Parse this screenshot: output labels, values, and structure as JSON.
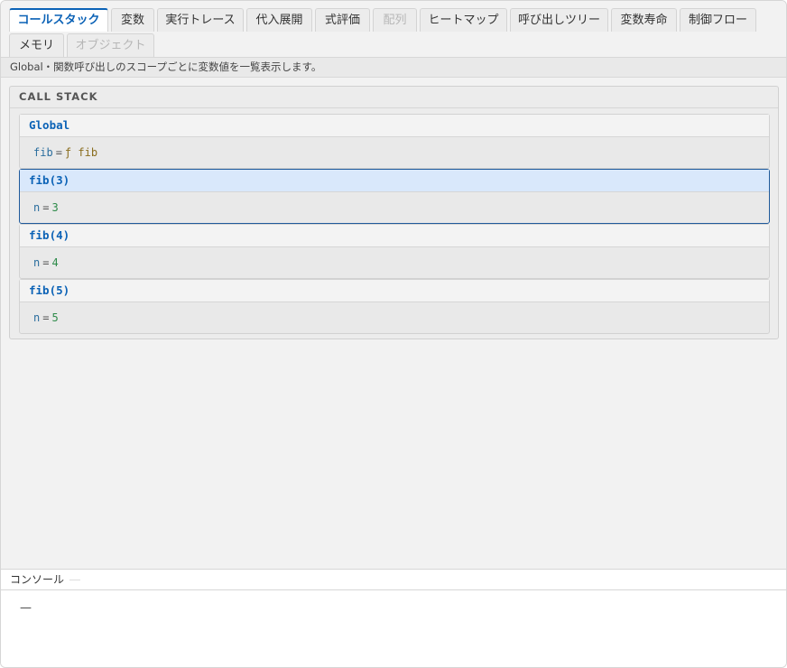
{
  "tabs": [
    {
      "label": "コールスタック",
      "state": "active"
    },
    {
      "label": "変数",
      "state": "normal"
    },
    {
      "label": "実行トレース",
      "state": "normal"
    },
    {
      "label": "代入展開",
      "state": "normal"
    },
    {
      "label": "式評価",
      "state": "normal"
    },
    {
      "label": "配列",
      "state": "disabled"
    },
    {
      "label": "ヒートマップ",
      "state": "normal"
    },
    {
      "label": "呼び出しツリー",
      "state": "normal"
    },
    {
      "label": "変数寿命",
      "state": "normal"
    },
    {
      "label": "制御フロー",
      "state": "normal"
    },
    {
      "label": "メモリ",
      "state": "normal"
    },
    {
      "label": "オブジェクト",
      "state": "disabled"
    }
  ],
  "description": "Global・関数呼び出しのスコープごとに変数値を一覧表示します。",
  "callstack": {
    "title": "CALL STACK",
    "frames": [
      {
        "name": "Global",
        "active": false,
        "var": {
          "name": "fib",
          "eq": "=",
          "value": "ƒ fib",
          "kind": "func"
        }
      },
      {
        "name": "fib(3)",
        "active": true,
        "var": {
          "name": "n",
          "eq": "=",
          "value": "3",
          "kind": "num"
        }
      },
      {
        "name": "fib(4)",
        "active": false,
        "var": {
          "name": "n",
          "eq": "=",
          "value": "4",
          "kind": "num"
        }
      },
      {
        "name": "fib(5)",
        "active": false,
        "var": {
          "name": "n",
          "eq": "=",
          "value": "5",
          "kind": "num"
        }
      }
    ]
  },
  "console": {
    "title": "コンソール",
    "output": "—"
  },
  "colors": {
    "accent": "#0b62b6",
    "active_frame_bg": "#d9e8fb",
    "number": "#2e8b4a",
    "function": "#8a6d1e"
  }
}
